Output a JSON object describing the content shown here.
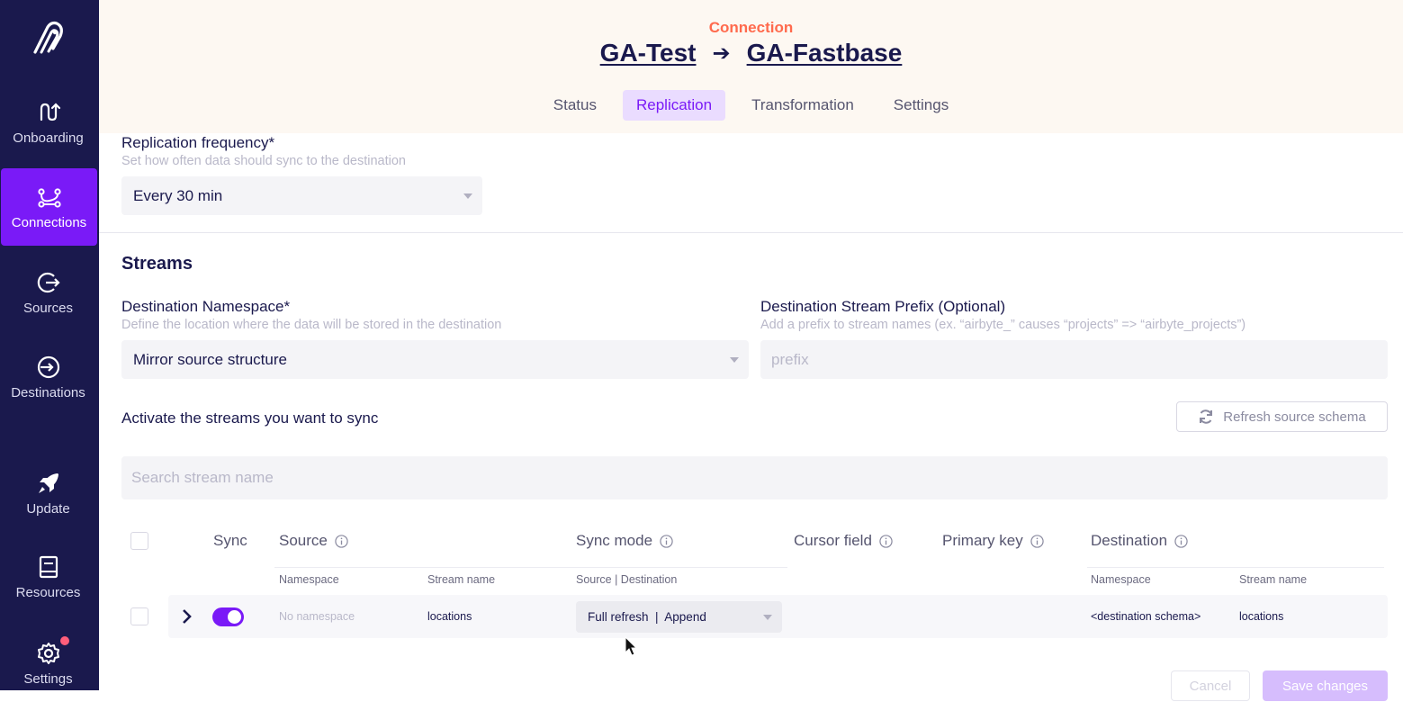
{
  "sidebar": {
    "items": [
      {
        "label": "Onboarding",
        "icon": "onboarding-icon"
      },
      {
        "label": "Connections",
        "icon": "connections-icon"
      },
      {
        "label": "Sources",
        "icon": "sources-icon"
      },
      {
        "label": "Destinations",
        "icon": "destinations-icon"
      },
      {
        "label": "Update",
        "icon": "rocket-icon"
      },
      {
        "label": "Resources",
        "icon": "book-icon"
      },
      {
        "label": "Settings",
        "icon": "gear-icon"
      }
    ],
    "active": "Connections"
  },
  "header": {
    "breadcrumb": "Connection",
    "source_name": "GA-Test",
    "arrow": "➔",
    "destination_name": "GA-Fastbase",
    "tabs": [
      "Status",
      "Replication",
      "Transformation",
      "Settings"
    ],
    "active_tab": "Replication"
  },
  "replication": {
    "frequency_label": "Replication frequency*",
    "frequency_help": "Set how often data should sync to the destination",
    "frequency_value": "Every 30 min"
  },
  "streams": {
    "title": "Streams",
    "namespace_label": "Destination Namespace*",
    "namespace_help": "Define the location where the data will be stored in the destination",
    "namespace_value": "Mirror source structure",
    "prefix_label": "Destination Stream Prefix (Optional)",
    "prefix_help": "Add a prefix to stream names (ex. “airbyte_” causes “projects” => “airbyte_projects”)",
    "prefix_placeholder": "prefix",
    "activate_text": "Activate the streams you want to sync",
    "refresh_label": "Refresh source schema",
    "search_placeholder": "Search stream name"
  },
  "table": {
    "headers": {
      "sync": "Sync",
      "source": "Source",
      "sync_mode": "Sync mode",
      "cursor_field": "Cursor field",
      "primary_key": "Primary key",
      "destination": "Destination"
    },
    "subheaders": {
      "source_namespace": "Namespace",
      "source_stream": "Stream name",
      "sync_mode": "Source | Destination",
      "dest_namespace": "Namespace",
      "dest_stream": "Stream name"
    },
    "rows": [
      {
        "source_namespace": "No namespace",
        "source_stream": "locations",
        "sync_mode": "Full refresh  |  Append",
        "dest_namespace": "<destination schema>",
        "dest_stream": "locations",
        "enabled": true
      }
    ]
  },
  "footer": {
    "cancel_label": "Cancel",
    "save_label": "Save changes"
  },
  "colors": {
    "sidebar_bg": "#1a194d",
    "accent": "#7a1af7",
    "breadcrumb": "#ff6a4d",
    "header_bg": "#fdf8f2"
  }
}
